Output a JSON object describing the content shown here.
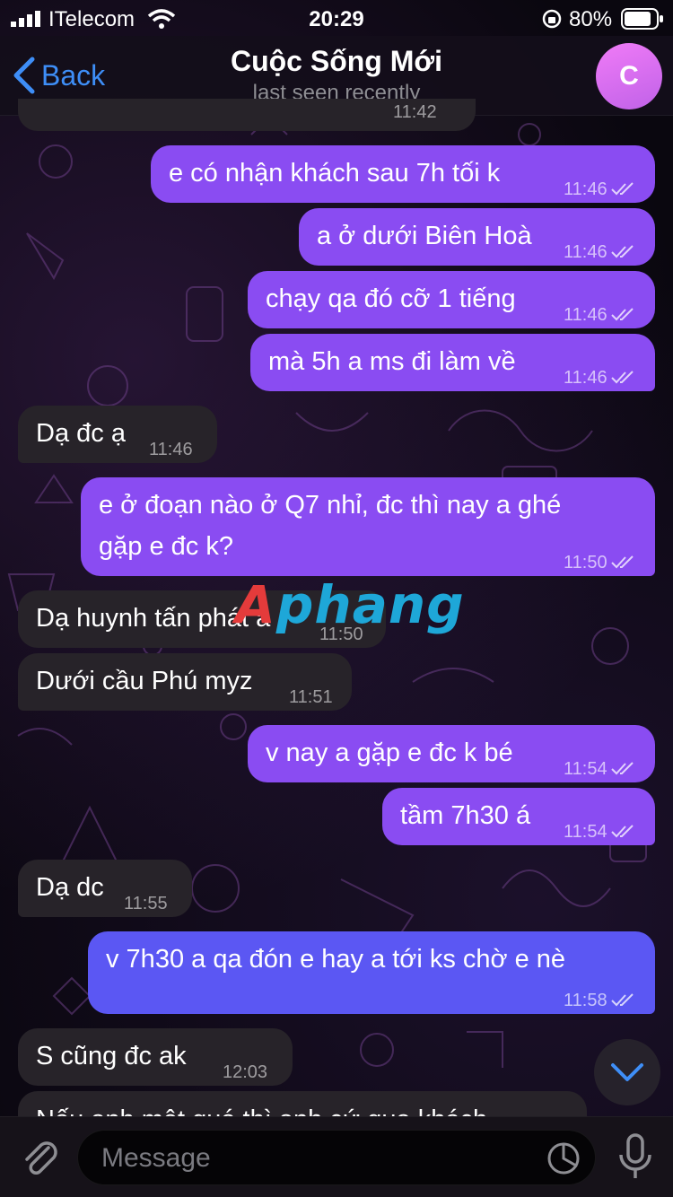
{
  "status_bar": {
    "carrier": "ITelecom",
    "time": "20:29",
    "battery": "80%"
  },
  "header": {
    "back_label": "Back",
    "title": "Cuộc Sống Mới",
    "subtitle": "last seen recently",
    "avatar_letter": "C"
  },
  "top_partial_time": "11:42",
  "messages": [
    {
      "dir": "out",
      "text": "e có nhận khách sau 7h tối k",
      "time": "11:46",
      "read": true
    },
    {
      "dir": "out",
      "text": "a ở dưới Biên Hoà",
      "time": "11:46",
      "read": true
    },
    {
      "dir": "out",
      "text": "chạy qa đó cỡ 1 tiếng",
      "time": "11:46",
      "read": true
    },
    {
      "dir": "out",
      "text": "mà 5h a ms đi làm về",
      "time": "11:46",
      "read": true
    },
    {
      "dir": "in",
      "text": "Dạ đc ạ",
      "time": "11:46"
    },
    {
      "dir": "out",
      "text_line1": "e ở đoạn nào ở Q7 nhỉ, đc thì nay a ghé",
      "text_line2": "gặp e đc k?",
      "time": "11:50",
      "read": true
    },
    {
      "dir": "in",
      "text": "Dạ huynh tấn phát a",
      "time": "11:50"
    },
    {
      "dir": "in",
      "text": "Dưới cầu Phú myz",
      "time": "11:51"
    },
    {
      "dir": "out",
      "text": "v nay a gặp e đc k bé",
      "time": "11:54",
      "read": true
    },
    {
      "dir": "out",
      "text": "tầm 7h30 á",
      "time": "11:54",
      "read": true
    },
    {
      "dir": "in",
      "text": "Dạ dc",
      "time": "11:55"
    },
    {
      "dir": "out",
      "text": "v 7h30 a qa đón e hay a tới ks chờ e nè",
      "time": "11:58",
      "read": true
    },
    {
      "dir": "in",
      "text": "S cũng đc ak",
      "time": "12:03"
    }
  ],
  "partial_message": "Nếu anh mệt quá thì anh cứ qua khách",
  "watermark": {
    "part1": "A",
    "part2": "phang"
  },
  "input": {
    "placeholder": "Message"
  },
  "icons": {
    "back": "chevron-left-icon",
    "scroll": "chevron-down-icon",
    "attach": "paperclip-icon",
    "sticker": "sticker-icon",
    "mic": "microphone-icon",
    "read": "double-check-icon"
  },
  "colors": {
    "outgoing": "#8a4cf2",
    "outgoing_alt": "#5b57f3",
    "incoming": "#272329",
    "accent": "#3e8ef7"
  }
}
